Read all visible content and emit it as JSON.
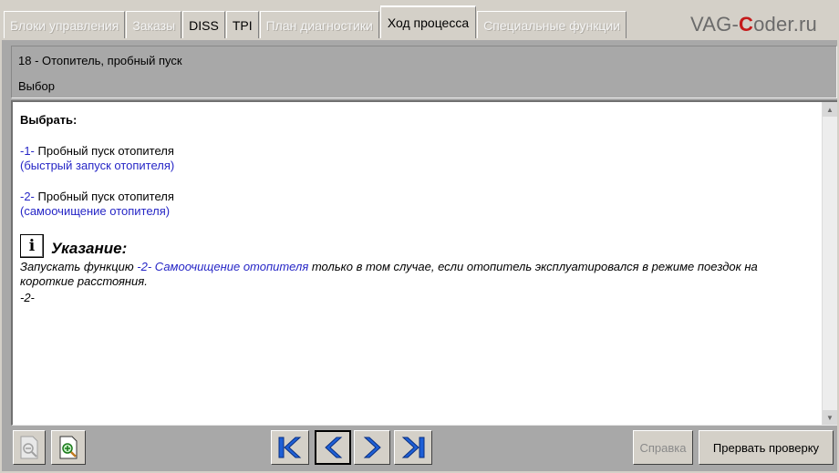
{
  "tabs": [
    {
      "label": "Блоки управления",
      "state": "disabled"
    },
    {
      "label": "Заказы",
      "state": "disabled"
    },
    {
      "label": "DISS",
      "state": "enabled"
    },
    {
      "label": "TPI",
      "state": "enabled"
    },
    {
      "label": "План диагностики",
      "state": "disabled"
    },
    {
      "label": "Ход процесса",
      "state": "active"
    },
    {
      "label": "Специальные функции",
      "state": "disabled"
    }
  ],
  "brand": {
    "pre": "VAG-",
    "accent": "C",
    "post": "oder.ru",
    "accent_color": "#c51b1b"
  },
  "header": {
    "title": "18 - Отопитель, пробный пуск",
    "subtitle": "Выбор"
  },
  "content": {
    "heading": "Выбрать:",
    "options": [
      {
        "num": "-1-",
        "label": "Пробный пуск отопителя",
        "desc": "(быстрый запуск отопителя)"
      },
      {
        "num": "-2-",
        "label": "Пробный пуск отопителя",
        "desc": "(самоочищение отопителя)"
      }
    ],
    "note": {
      "icon": "info-icon",
      "icon_glyph": "i",
      "title": "Указание:",
      "text_before": "Запускать функцию ",
      "link_num": "-2-",
      "link_text": "Самоочищение отопителя",
      "text_after": " только в том случае, если отопитель эксплуатировался в режиме поездок на короткие расстояния.",
      "footer": "-2-"
    }
  },
  "toolbar": {
    "help_label": "Справка",
    "abort_label": "Прервать проверку"
  },
  "colors": {
    "link_blue": "#2626c6",
    "nav_icon_blue": "#1e5fd6",
    "frame_gray": "#a8a8a8",
    "tab_bg": "#d4d0c8"
  }
}
